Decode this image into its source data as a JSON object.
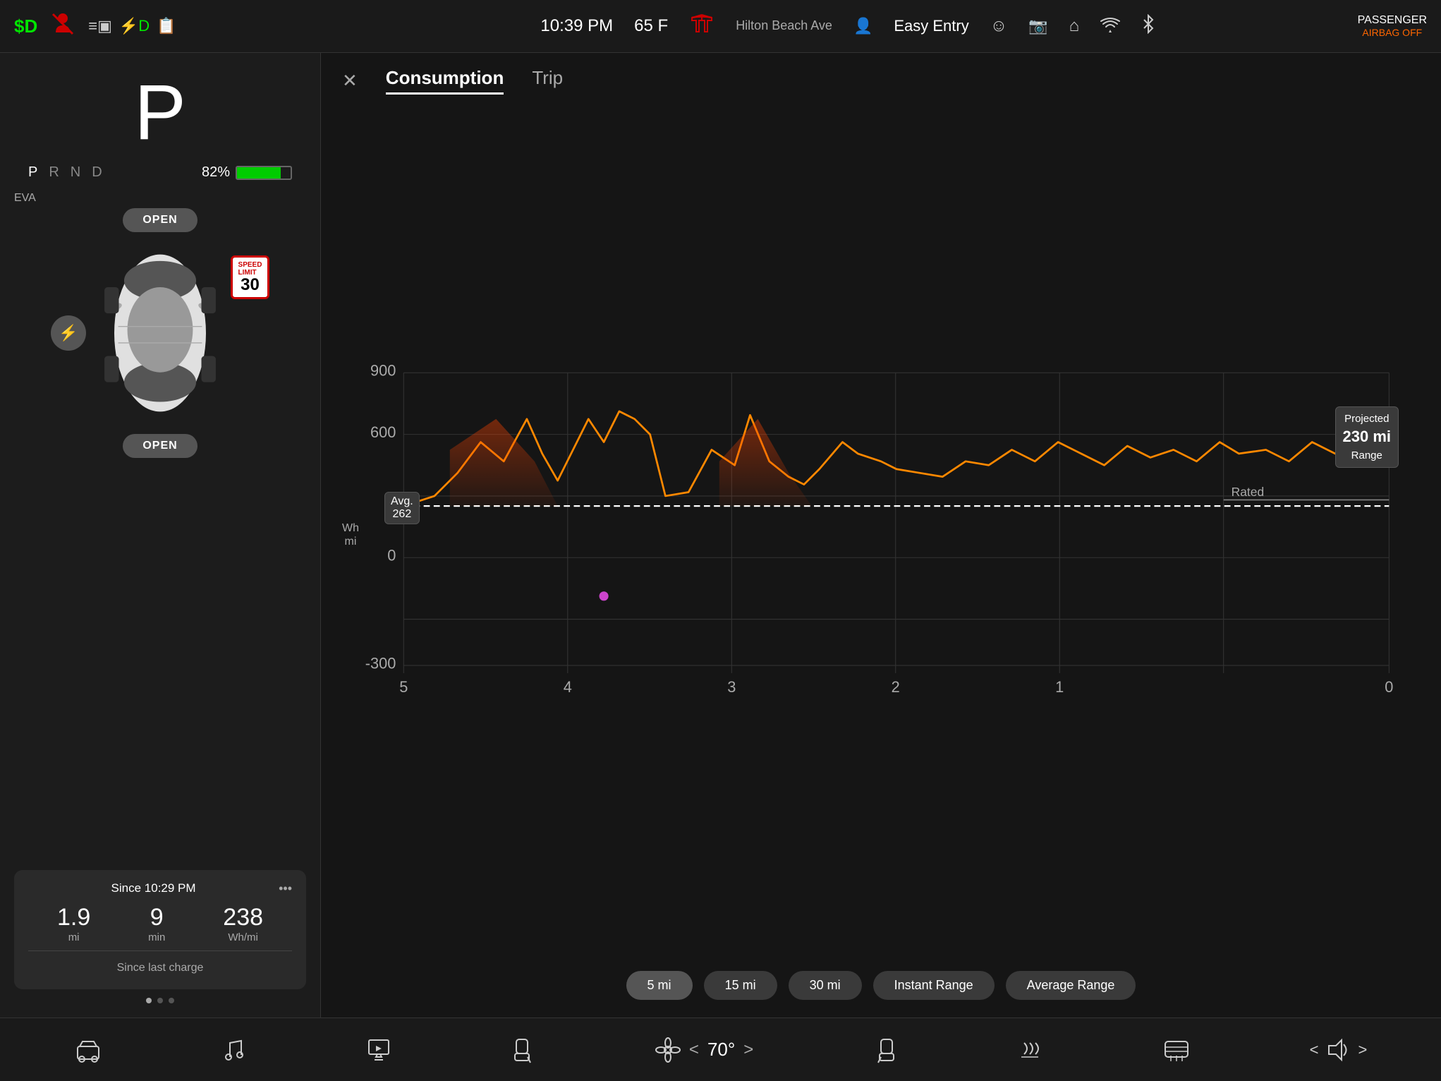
{
  "statusBar": {
    "leftIcons": {
      "dollarD": "$D",
      "warningIcon": "⚠",
      "docIcon": "≡▣",
      "plugIcon": "⚡",
      "clipIcon": "📋"
    },
    "time": "10:39 PM",
    "temp": "65 F",
    "teslaLogo": "T",
    "street": "Hilton Beach Ave",
    "personIcon": "👤",
    "easyEntry": "Easy Entry",
    "smileyIcon": "☺",
    "cameraIcon": "📷",
    "homeIcon": "⌂",
    "wifiIcon": "WiFi",
    "bluetoothIcon": "⚡",
    "passengerAirbag": "PASSENGER",
    "airbagStatus": "AIRBAG OFF"
  },
  "leftPanel": {
    "gear": "P",
    "gearOptions": [
      "P",
      "R",
      "N",
      "D"
    ],
    "activeGear": "P",
    "batteryPercent": "82%",
    "evaLabel": "EVA",
    "topDoorBtn": "OPEN",
    "bottomDoorBtn": "OPEN",
    "speedLimit": {
      "label": "SPEED LIMIT",
      "value": "30"
    },
    "tripStats": {
      "since": "Since 10:29 PM",
      "dotsMenu": "•••",
      "values": [
        {
          "num": "1.9",
          "unit": "mi"
        },
        {
          "num": "9",
          "unit": "min"
        },
        {
          "num": "238",
          "unit": "Wh/mi"
        }
      ],
      "sinceCharge": "Since last charge"
    }
  },
  "rightPanel": {
    "closeBtn": "✕",
    "tabs": [
      {
        "label": "Consumption",
        "active": true
      },
      {
        "label": "Trip",
        "active": false
      }
    ],
    "yAxisLabel": "Wh\nmi",
    "avgBadge": {
      "label": "Avg.",
      "value": "262"
    },
    "projectedBadge": {
      "prefix": "Projected",
      "value": "230 mi",
      "suffix": "Range"
    },
    "ratedLabel": "Rated",
    "yAxisValues": [
      "900",
      "600",
      "0",
      "-300"
    ],
    "xAxisValues": [
      "5",
      "4",
      "3",
      "2",
      "1",
      "0"
    ],
    "chartButtons": [
      {
        "label": "5 mi",
        "active": true
      },
      {
        "label": "15 mi",
        "active": false
      },
      {
        "label": "30 mi",
        "active": false
      },
      {
        "label": "Instant Range",
        "active": false
      },
      {
        "label": "Average Range",
        "active": false
      }
    ]
  },
  "taskbar": {
    "items": [
      {
        "icon": "🚗",
        "name": "car"
      },
      {
        "icon": "♪",
        "name": "music"
      },
      {
        "icon": "⬆",
        "name": "media"
      }
    ],
    "seat1Icon": "🪑",
    "fanIcon": "❄",
    "temperature": "< 70° >",
    "seat2Icon": "🪑",
    "rearHeatIcon": "≋",
    "rearDefrostIcon": "≋",
    "volumeLeft": "‹",
    "volumeIcon": "🔊",
    "volumeRight": "›"
  }
}
